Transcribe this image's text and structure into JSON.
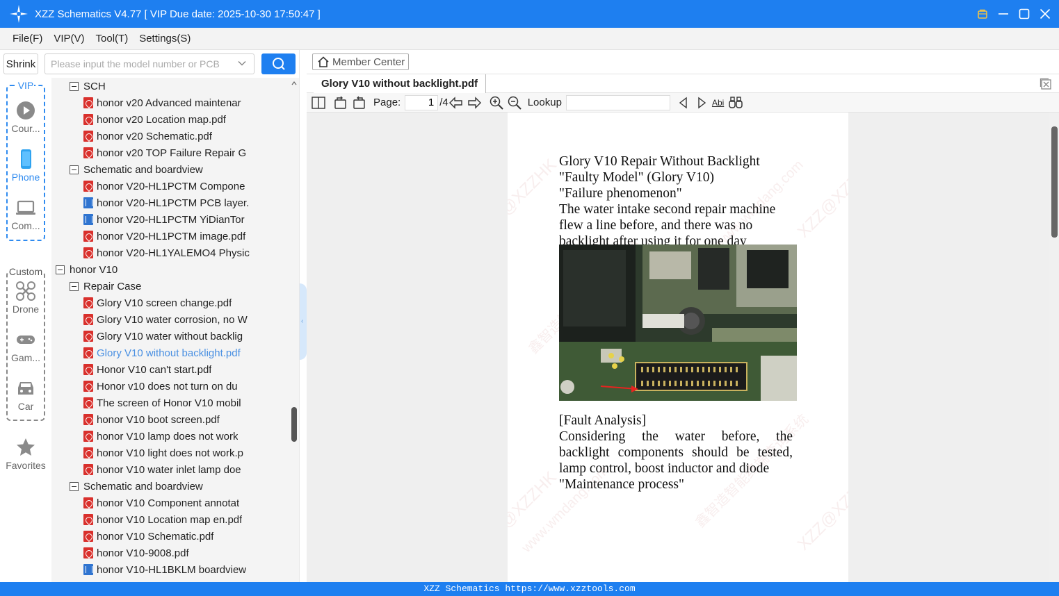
{
  "window": {
    "title": "XZZ Schematics V4.77 [ VIP Due date: 2025-10-30 17:50:47 ]"
  },
  "menu": [
    "File(F)",
    "VIP(V)",
    "Tool(T)",
    "Settings(S)"
  ],
  "search": {
    "shrink_label": "Shrink",
    "placeholder": "Please input the model number or PCB"
  },
  "sidebar": {
    "vip_group_title": "VIP",
    "custom_group_title": "Custom",
    "items": [
      {
        "label": "Cour...",
        "icon": "play-icon"
      },
      {
        "label": "Phone",
        "icon": "phone-icon"
      },
      {
        "label": "Com...",
        "icon": "laptop-icon"
      },
      {
        "label": "Drone",
        "icon": "drone-icon"
      },
      {
        "label": "Gam...",
        "icon": "gamepad-icon"
      },
      {
        "label": "Car",
        "icon": "car-icon"
      },
      {
        "label": "Favorites",
        "icon": "star-icon"
      }
    ]
  },
  "tree": [
    {
      "type": "folder",
      "label": "SCH"
    },
    {
      "type": "pdf",
      "label": "honor v20 Advanced maintenar"
    },
    {
      "type": "pdf",
      "label": "honor v20 Location map.pdf"
    },
    {
      "type": "pdf",
      "label": "honor v20 Schematic.pdf"
    },
    {
      "type": "pdf",
      "label": "honor v20 TOP Failure Repair G"
    },
    {
      "type": "folder",
      "label": "Schematic and boardview"
    },
    {
      "type": "pdf",
      "label": "honor V20-HL1PCTM Compone"
    },
    {
      "type": "bv",
      "label": "honor V20-HL1PCTM PCB layer."
    },
    {
      "type": "bv",
      "label": "honor V20-HL1PCTM YiDianTor"
    },
    {
      "type": "pdf",
      "label": "honor V20-HL1PCTM image.pdf"
    },
    {
      "type": "pdf",
      "label": "honor V20-HL1YALEMO4 Physic"
    },
    {
      "type": "folder",
      "label": "honor V10"
    },
    {
      "type": "folder",
      "label": "Repair Case"
    },
    {
      "type": "pdf",
      "label": "Glory V10 screen change.pdf"
    },
    {
      "type": "pdf",
      "label": "Glory V10 water corrosion, no W"
    },
    {
      "type": "pdf",
      "label": "Glory V10 water without backlig"
    },
    {
      "type": "pdf",
      "label": "Glory V10 without backlight.pdf"
    },
    {
      "type": "pdf",
      "label": "Honor V10 can't start.pdf"
    },
    {
      "type": "pdf",
      "label": "Honor v10 does not turn on du"
    },
    {
      "type": "pdf",
      "label": "The screen of Honor V10 mobil"
    },
    {
      "type": "pdf",
      "label": "honor V10 boot screen.pdf"
    },
    {
      "type": "pdf",
      "label": "honor V10 lamp does not work"
    },
    {
      "type": "pdf",
      "label": "honor V10 light does not work.p"
    },
    {
      "type": "pdf",
      "label": "honor V10 water inlet lamp doe"
    },
    {
      "type": "folder",
      "label": "Schematic and boardview"
    },
    {
      "type": "pdf",
      "label": "honor V10 Component annotat"
    },
    {
      "type": "pdf",
      "label": "honor V10 Location map en.pdf"
    },
    {
      "type": "pdf",
      "label": "honor V10 Schematic.pdf"
    },
    {
      "type": "pdf",
      "label": "honor V10-9008.pdf"
    },
    {
      "type": "bv",
      "label": "honor V10-HL1BKLM boardview"
    }
  ],
  "main": {
    "member_center_label": "Member Center",
    "active_tab": "Glory V10 without backlight.pdf",
    "toolbar": {
      "page_label": "Page:",
      "page_value": "1",
      "page_total": "/4",
      "lookup_label": "Lookup",
      "abi_label": "Abi"
    }
  },
  "pdf": {
    "heading_lines": [
      "Glory V10 Repair Without Backlight",
      "\"Faulty Model\" (Glory V10)",
      "\"Failure phenomenon\"",
      "The water intake second repair machine",
      "flew a line before, and there was no",
      "backlight after using it for one day"
    ],
    "analysis_lines": [
      "[Fault Analysis]",
      "Considering the water before, the",
      "backlight components should be tested,",
      "lamp control, boost inductor and diode",
      "\"Maintenance process\""
    ],
    "watermarks": [
      "XZZ@XZZHK",
      "鑫智造智能终端查询系统",
      "www.wmdang.com"
    ]
  },
  "status": {
    "text": "XZZ Schematics https://www.xzztools.com"
  },
  "colors": {
    "accent": "#1e7ff0",
    "selected_text": "#4a90e2",
    "pdf_icon": "#d9302c",
    "boardview_icon": "#2f74d0"
  }
}
